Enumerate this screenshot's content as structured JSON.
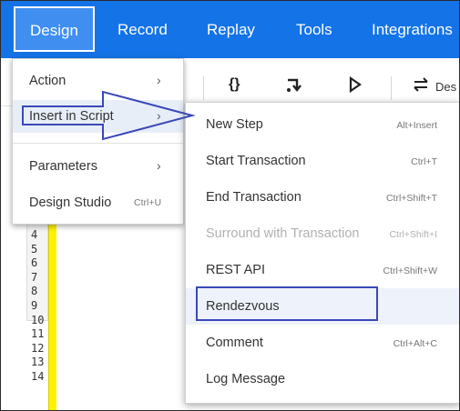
{
  "topbar": {
    "tabs": [
      {
        "label": "Design"
      },
      {
        "label": "Record"
      },
      {
        "label": "Replay"
      },
      {
        "label": "Tools"
      },
      {
        "label": "Integrations"
      }
    ]
  },
  "toolbar": {
    "icons": [
      "braces-icon",
      "step-over-icon",
      "play-icon",
      "swap-icon"
    ],
    "partial_label": "Des"
  },
  "editor": {
    "line_numbers": [
      "4",
      "5",
      "6",
      "7",
      "8",
      "9",
      "10",
      "11",
      "12",
      "13",
      "14"
    ]
  },
  "design_menu": {
    "items": [
      {
        "label": "Action",
        "chevron": "›"
      },
      {
        "label": "Insert in Script",
        "chevron": "›"
      },
      {
        "label": "Parameters",
        "chevron": "›"
      },
      {
        "label": "Design Studio",
        "shortcut": "Ctrl+U"
      }
    ]
  },
  "insert_submenu": {
    "items": [
      {
        "label": "New Step",
        "shortcut": "Alt+Insert"
      },
      {
        "label": "Start Transaction",
        "shortcut": "Ctrl+T"
      },
      {
        "label": "End Transaction",
        "shortcut": "Ctrl+Shift+T"
      },
      {
        "label": "Surround with Transaction",
        "shortcut": "Ctrl+Shift+I"
      },
      {
        "label": "REST API",
        "shortcut": "Ctrl+Shift+W"
      },
      {
        "label": "Rendezvous",
        "shortcut": ""
      },
      {
        "label": "Comment",
        "shortcut": "Ctrl+Alt+C"
      },
      {
        "label": "Log Message",
        "shortcut": ""
      }
    ]
  },
  "colors": {
    "ribbon": "#1473e6",
    "annotation": "#3a48b8",
    "gutter_marker": "#fff200"
  }
}
